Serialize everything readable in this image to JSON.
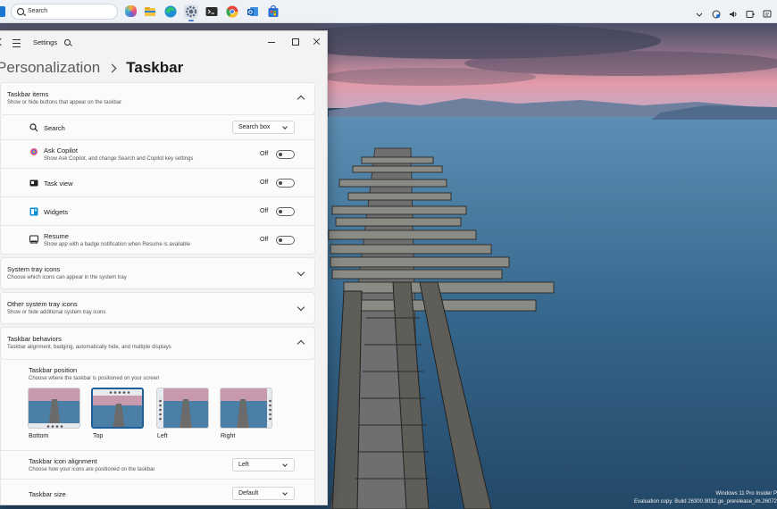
{
  "taskbar": {
    "search_placeholder": "Search",
    "apps": [
      "copilot-icon",
      "file-explorer-icon",
      "edge-icon",
      "settings-icon",
      "terminal-icon",
      "chrome-icon",
      "outlook-icon",
      "store-icon"
    ],
    "active_app": "settings-icon",
    "tray": [
      "chevron-up-icon",
      "network-icon",
      "volume-icon",
      "battery-icon",
      "notification-icon"
    ]
  },
  "window": {
    "app_title": "Settings",
    "breadcrumb_parent": "Personalization",
    "breadcrumb_current": "Taskbar"
  },
  "taskbar_items": {
    "title": "Taskbar items",
    "desc": "Show or hide buttons that appear on the taskbar",
    "search": {
      "label": "Search",
      "value": "Search box"
    },
    "copilot": {
      "label": "Ask Copilot",
      "desc": "Show Ask Copilot, and change Search and Copilot key settings",
      "state": "Off"
    },
    "taskview": {
      "label": "Task view",
      "state": "Off"
    },
    "widgets": {
      "label": "Widgets",
      "state": "Off"
    },
    "resume": {
      "label": "Resume",
      "desc": "Show app with a badge notification when Resume is available",
      "state": "Off"
    }
  },
  "system_tray": {
    "title": "System tray icons",
    "desc": "Choose which icons can appear in the system tray"
  },
  "other_tray": {
    "title": "Other system tray icons",
    "desc": "Show or hide additional system tray icons"
  },
  "behaviors": {
    "title": "Taskbar behaviors",
    "desc": "Taskbar alignment, badging, automatically hide, and multiple displays",
    "position": {
      "title": "Taskbar position",
      "desc": "Choose where the taskbar is positioned on your screen",
      "options": [
        "Bottom",
        "Top",
        "Left",
        "Right"
      ],
      "selected": "Top"
    },
    "alignment": {
      "title": "Taskbar icon alignment",
      "desc": "Choose how your icons are positioned on the taskbar",
      "value": "Left"
    },
    "size": {
      "title": "Taskbar size",
      "value": "Default"
    }
  },
  "watermark": {
    "line1": "Windows 11 Pro Insider P",
    "line2": "Evaluation copy. Build 26300.9032.ge_prerelease_im.26072"
  }
}
